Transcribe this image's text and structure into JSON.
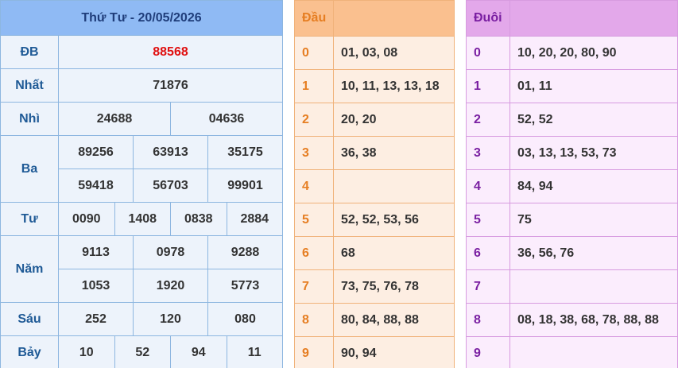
{
  "results": {
    "title": "Thứ Tư - 20/05/2026",
    "prizes": [
      {
        "label": "ĐB",
        "rows": [
          [
            "88568"
          ]
        ]
      },
      {
        "label": "Nhất",
        "rows": [
          [
            "71876"
          ]
        ]
      },
      {
        "label": "Nhì",
        "rows": [
          [
            "24688",
            "04636"
          ]
        ]
      },
      {
        "label": "Ba",
        "rows": [
          [
            "89256",
            "63913",
            "35175"
          ],
          [
            "59418",
            "56703",
            "99901"
          ]
        ]
      },
      {
        "label": "Tư",
        "rows": [
          [
            "0090",
            "1408",
            "0838",
            "2884"
          ]
        ]
      },
      {
        "label": "Năm",
        "rows": [
          [
            "9113",
            "0978",
            "9288"
          ],
          [
            "1053",
            "1920",
            "5773"
          ]
        ]
      },
      {
        "label": "Sáu",
        "rows": [
          [
            "252",
            "120",
            "080"
          ]
        ]
      },
      {
        "label": "Bảy",
        "rows": [
          [
            "10",
            "52",
            "94",
            "11"
          ]
        ]
      }
    ]
  },
  "dau": {
    "title": "Đầu",
    "rows": [
      {
        "key": "0",
        "value": "01, 03, 08"
      },
      {
        "key": "1",
        "value": "10, 11, 13, 13, 18"
      },
      {
        "key": "2",
        "value": "20, 20"
      },
      {
        "key": "3",
        "value": "36, 38"
      },
      {
        "key": "4",
        "value": ""
      },
      {
        "key": "5",
        "value": "52, 52, 53, 56"
      },
      {
        "key": "6",
        "value": "68"
      },
      {
        "key": "7",
        "value": "73, 75, 76, 78"
      },
      {
        "key": "8",
        "value": "80, 84, 88, 88"
      },
      {
        "key": "9",
        "value": "90, 94"
      }
    ]
  },
  "duoi": {
    "title": "Đuôi",
    "rows": [
      {
        "key": "0",
        "value": "10, 20, 20, 80, 90"
      },
      {
        "key": "1",
        "value": "01, 11"
      },
      {
        "key": "2",
        "value": "52, 52"
      },
      {
        "key": "3",
        "value": "03, 13, 13, 53, 73"
      },
      {
        "key": "4",
        "value": "84, 94"
      },
      {
        "key": "5",
        "value": "75"
      },
      {
        "key": "6",
        "value": "36, 56, 76"
      },
      {
        "key": "7",
        "value": ""
      },
      {
        "key": "8",
        "value": "08, 18, 38, 68, 78, 88, 88"
      },
      {
        "key": "9",
        "value": ""
      }
    ]
  }
}
